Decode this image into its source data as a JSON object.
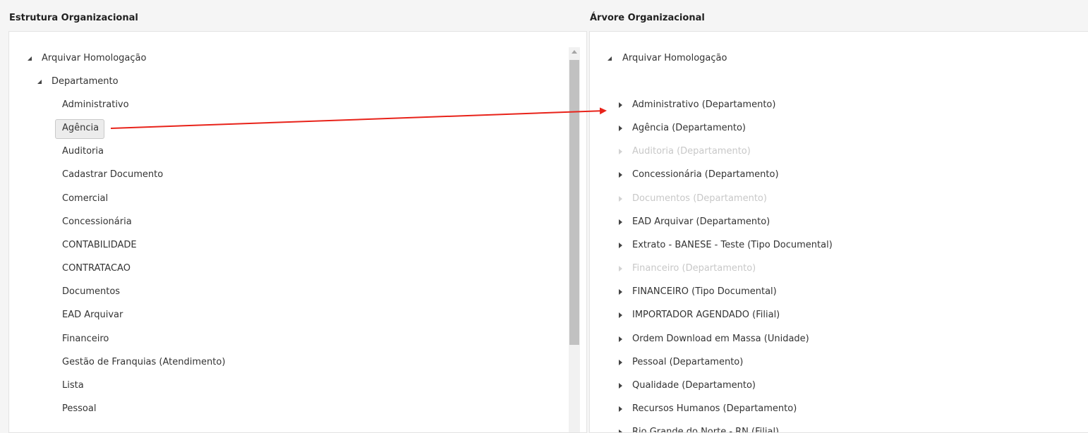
{
  "left": {
    "title": "Estrutura Organizacional",
    "root": "Arquivar Homologação",
    "child": "Departamento",
    "items": [
      "Administrativo",
      "Agência",
      "Auditoria",
      "Cadastrar Documento",
      "Comercial",
      "Concessionária",
      "CONTABILIDADE",
      "CONTRATACAO",
      "Documentos",
      "EAD Arquivar",
      "Financeiro",
      "Gestão de Franquias (Atendimento)",
      "Lista",
      "Pessoal"
    ],
    "selected_item": "Agência"
  },
  "right": {
    "title": "Árvore Organizacional",
    "root": "Arquivar Homologação",
    "items": [
      {
        "label": "Administrativo (Departamento)",
        "disabled": false
      },
      {
        "label": "Agência (Departamento)",
        "disabled": false
      },
      {
        "label": "Auditoria (Departamento)",
        "disabled": true
      },
      {
        "label": "Concessionária (Departamento)",
        "disabled": false
      },
      {
        "label": "Documentos (Departamento)",
        "disabled": true
      },
      {
        "label": "EAD Arquivar (Departamento)",
        "disabled": false
      },
      {
        "label": "Extrato - BANESE - Teste (Tipo Documental)",
        "disabled": false
      },
      {
        "label": "Financeiro (Departamento)",
        "disabled": true
      },
      {
        "label": "FINANCEIRO (Tipo Documental)",
        "disabled": false
      },
      {
        "label": "IMPORTADOR AGENDADO (Filial)",
        "disabled": false
      },
      {
        "label": "Ordem Download em Massa (Unidade)",
        "disabled": false
      },
      {
        "label": "Pessoal (Departamento)",
        "disabled": false
      },
      {
        "label": "Qualidade (Departamento)",
        "disabled": false
      },
      {
        "label": "Recursos Humanos (Departamento)",
        "disabled": false
      },
      {
        "label": "Rio Grande do Norte - RN (Filial)",
        "disabled": false
      }
    ]
  },
  "colors": {
    "arrow": "#e8231a",
    "disabled_text": "#c8c8c8"
  }
}
